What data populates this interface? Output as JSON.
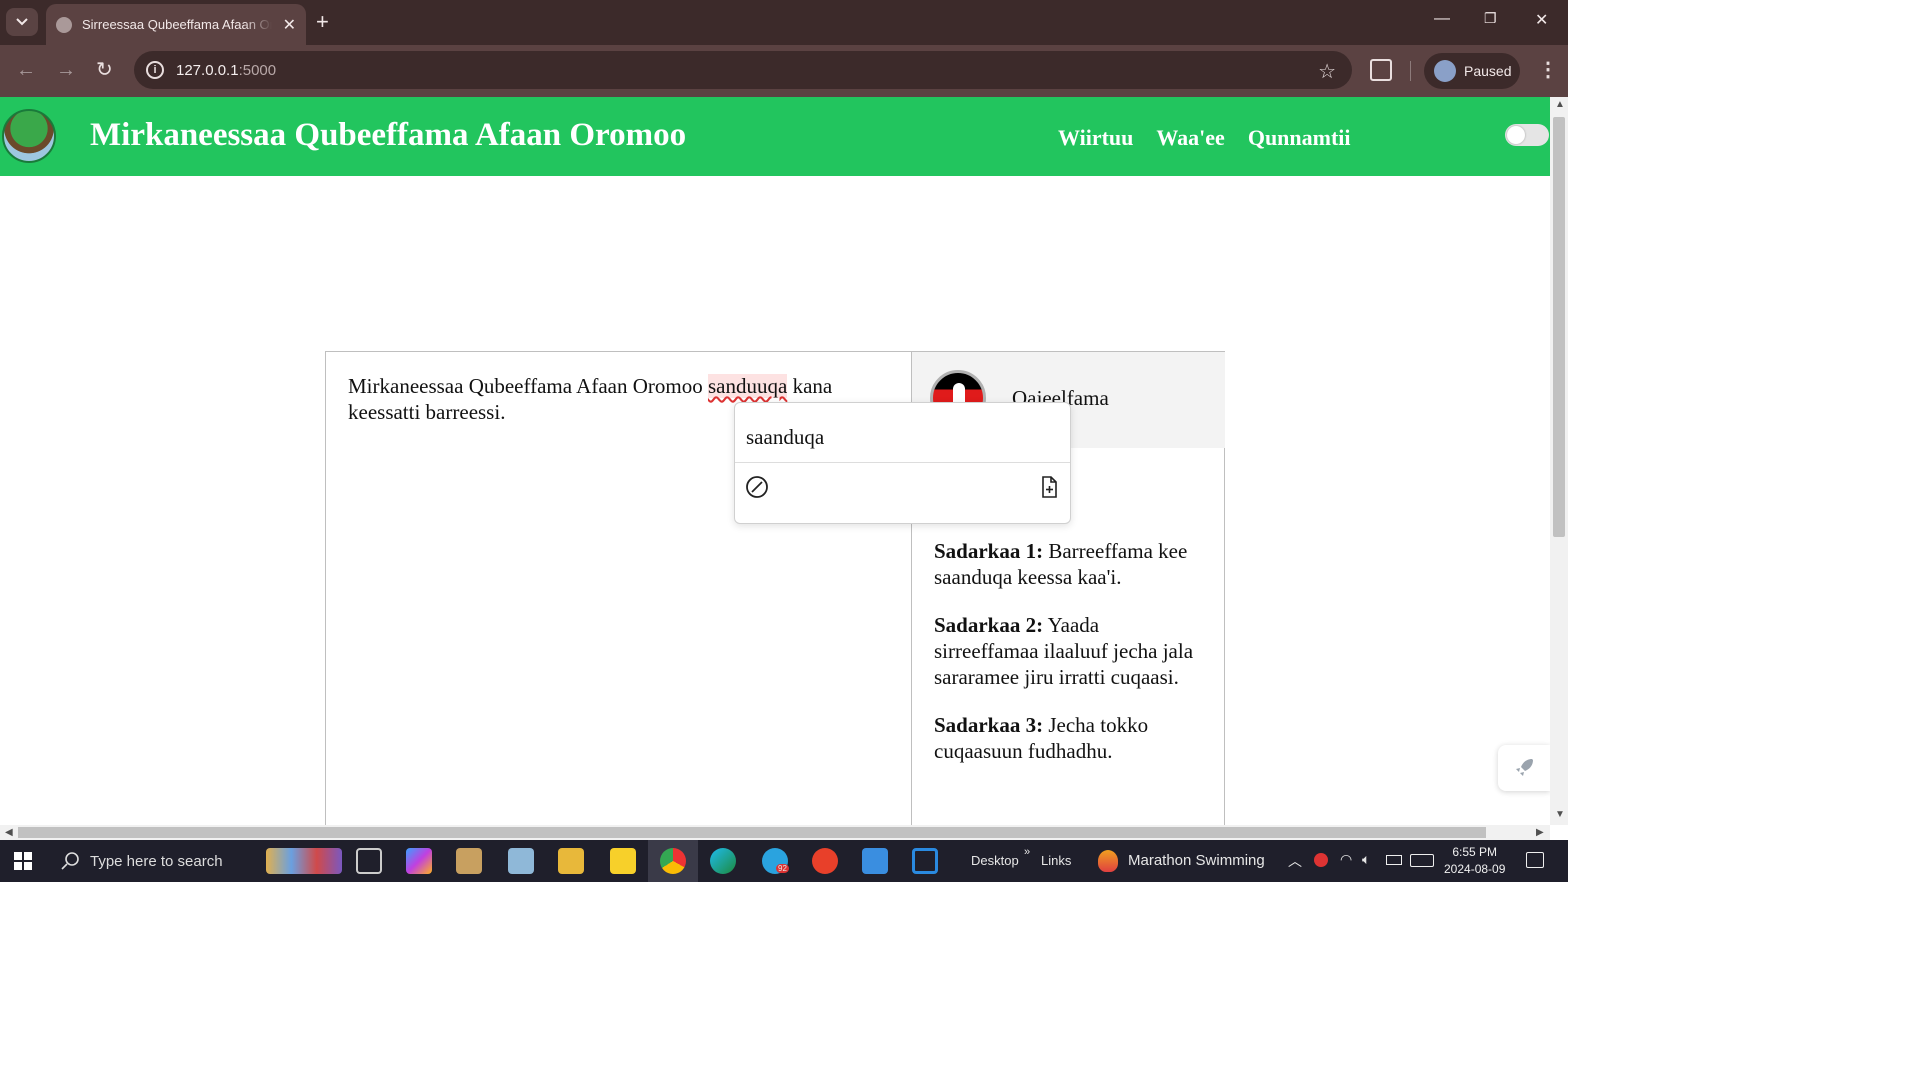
{
  "browser": {
    "tab_title": "Sirreessaa Qubeeffama Afaan Oromoo",
    "url_host": "127.0.0.1",
    "url_port": ":5000",
    "profile_label": "Paused"
  },
  "header": {
    "title": "Mirkaneessaa Qubeeffama Afaan Oromoo",
    "nav": [
      "Wiirtuu",
      "Waa'ee",
      "Qunnamtii"
    ]
  },
  "editor": {
    "text_before": "Mirkaneessaa Qubeeffama Afaan Oromoo ",
    "misspelled_word": "sanduuqa",
    "text_after": " kana keessatti barreessi."
  },
  "popup": {
    "suggestion": "saanduqa",
    "ignore_icon": "ignore-icon",
    "add_icon": "add-to-dictionary-icon"
  },
  "panel": {
    "title": "Qajeelfama",
    "steps": [
      {
        "label": "Sadarkaa 1:",
        "text": "Barreeffama kee saanduqa keessa kaa'i."
      },
      {
        "label": "Sadarkaa 2:",
        "text": "Yaada sirreeffamaa ilaaluuf jecha jala sararamee jiru irratti cuqaasi."
      },
      {
        "label": "Sadarkaa 3:",
        "text": "Jecha tokko cuqaasuun fudhadhu."
      }
    ]
  },
  "taskbar": {
    "search_placeholder": "Type here to search",
    "desktop_label": "Desktop",
    "links_label": "Links",
    "media_label": "Marathon Swimming",
    "telegram_badge": "92",
    "time": "6:55 PM",
    "date": "2024-08-09"
  },
  "colors": {
    "header_green": "#22c55e",
    "chrome_dark": "#3c2a2a",
    "chrome_mid": "#5b4242",
    "misspell_red": "#d33"
  }
}
